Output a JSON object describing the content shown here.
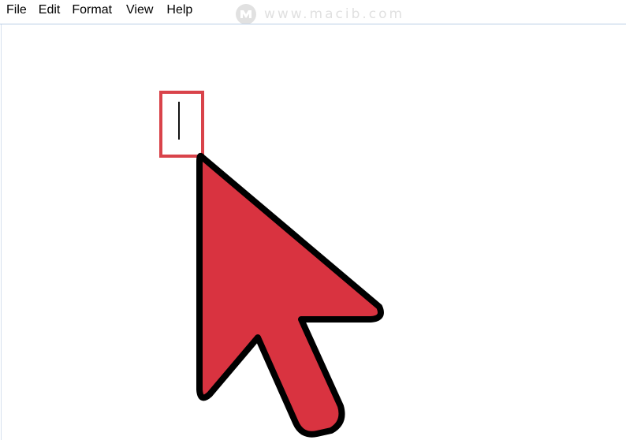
{
  "menubar": {
    "items": [
      {
        "label": "File"
      },
      {
        "label": "Edit"
      },
      {
        "label": "Format"
      },
      {
        "label": "View"
      },
      {
        "label": "Help"
      }
    ]
  },
  "watermark": {
    "text": "www.macib.com",
    "icon": "macib-logo-icon"
  },
  "editor": {
    "caret_icon": "text-cursor-icon",
    "highlight_color": "#d9434a",
    "pointer_icon": "mouse-pointer-icon",
    "pointer_color": "#d93340"
  }
}
